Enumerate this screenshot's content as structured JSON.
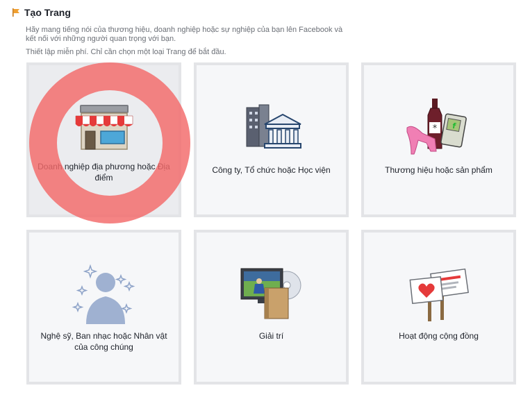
{
  "header": {
    "title": "Tạo Trang",
    "description_line1": "Hãy mang tiếng nói của thương hiệu, doanh nghiệp hoặc sự nghiệp của bạn lên Facebook và kết nối với những người quan trọng với bạn.",
    "description_line2": "Thiết lập miễn phí. Chỉ cần chọn một loại Trang để bắt đầu."
  },
  "categories": [
    {
      "label": "Doanh nghiệp địa phương hoặc Địa điểm",
      "icon": "storefront-icon",
      "selected": true
    },
    {
      "label": "Công ty, Tổ chức hoặc Học viện",
      "icon": "office-buildings-icon",
      "selected": false
    },
    {
      "label": "Thương hiệu hoặc sản phẩm",
      "icon": "brand-products-icon",
      "selected": false
    },
    {
      "label": "Nghệ sỹ, Ban nhạc hoặc Nhân vật của công chúng",
      "icon": "public-figure-icon",
      "selected": false
    },
    {
      "label": "Giải trí",
      "icon": "entertainment-icon",
      "selected": false
    },
    {
      "label": "Hoạt động cộng đồng",
      "icon": "protest-signs-icon",
      "selected": false
    }
  ],
  "colors": {
    "highlight_ring": "#f36969",
    "card_border": "#e3e4e7",
    "card_bg": "#f6f7f9"
  }
}
